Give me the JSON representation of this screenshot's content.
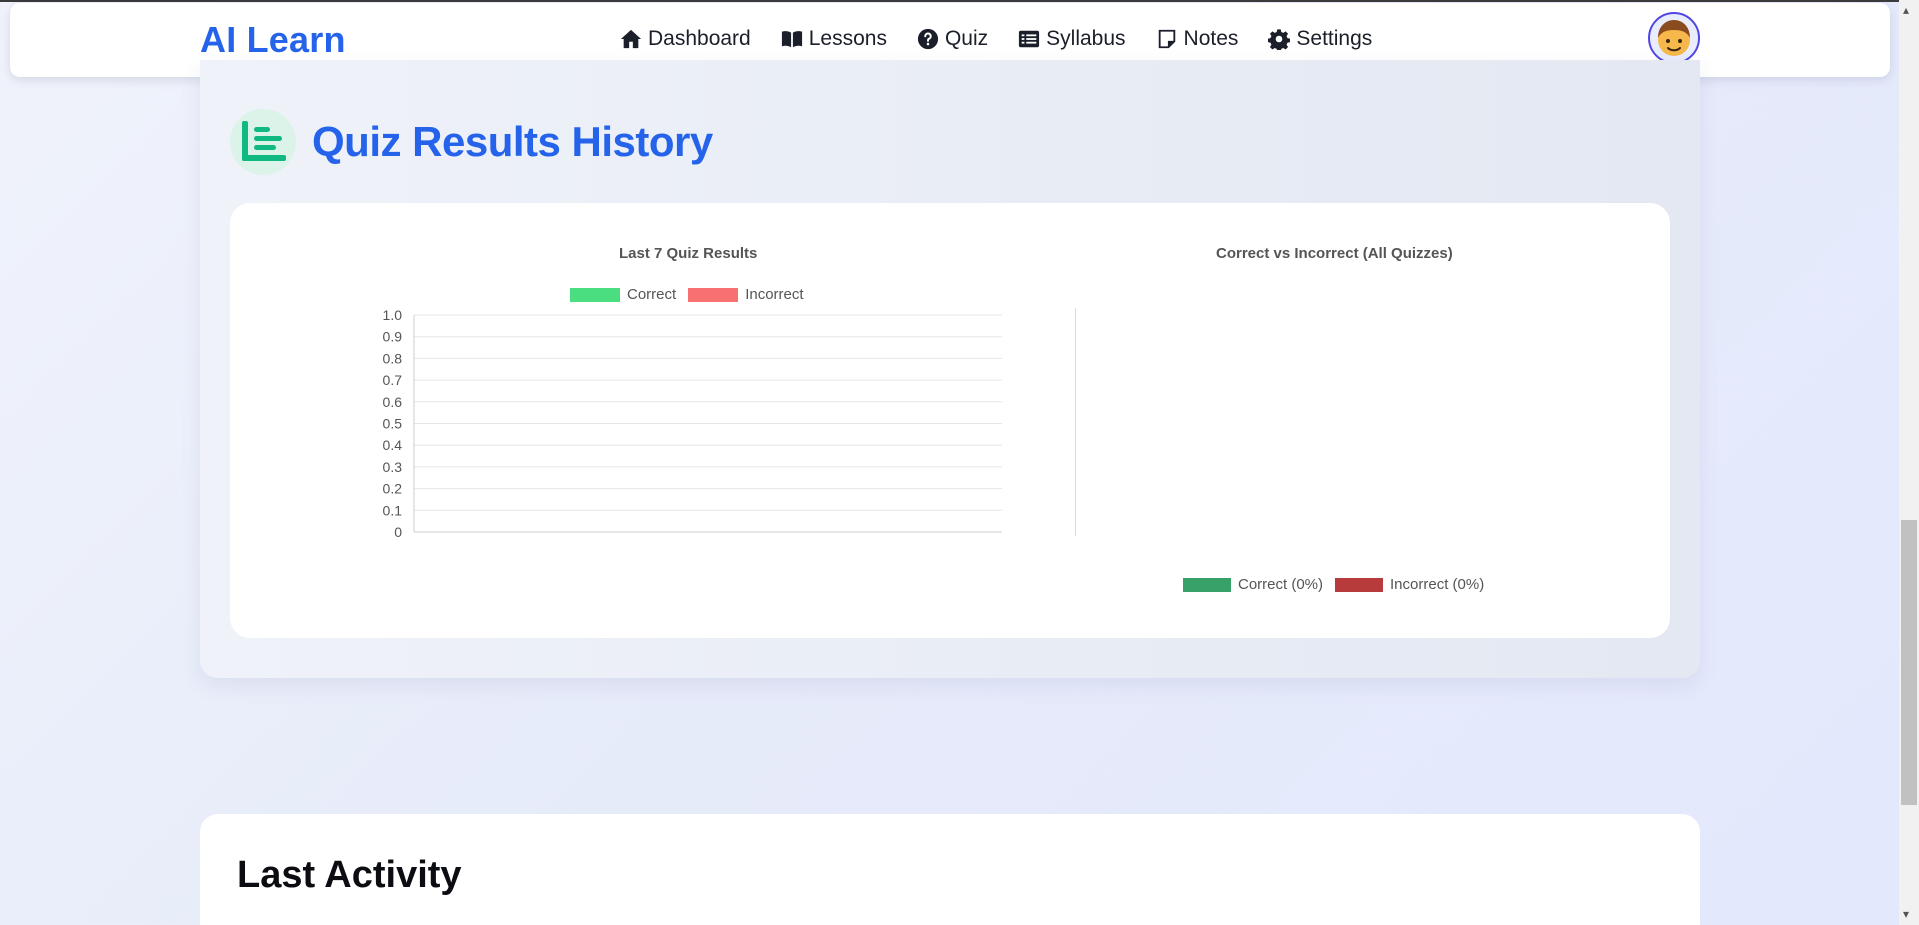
{
  "brand": "AI Learn",
  "nav": [
    {
      "label": "Dashboard",
      "icon": "home-icon"
    },
    {
      "label": "Lessons",
      "icon": "book-icon"
    },
    {
      "label": "Quiz",
      "icon": "question-circle-icon"
    },
    {
      "label": "Syllabus",
      "icon": "list-icon"
    },
    {
      "label": "Notes",
      "icon": "note-icon"
    },
    {
      "label": "Settings",
      "icon": "gear-icon"
    }
  ],
  "section": {
    "title": "Quiz Results History",
    "icon": "bar-chart-icon"
  },
  "chart_data": [
    {
      "type": "bar",
      "title": "Last 7 Quiz Results",
      "categories": [],
      "series": [
        {
          "name": "Correct",
          "values": [],
          "color": "#4ade80"
        },
        {
          "name": "Incorrect",
          "values": [],
          "color": "#f87171"
        }
      ],
      "ylim": [
        0,
        1.0
      ],
      "yticks": [
        "1.0",
        "0.9",
        "0.8",
        "0.7",
        "0.6",
        "0.5",
        "0.4",
        "0.3",
        "0.2",
        "0.1",
        "0"
      ],
      "grid": true,
      "legend": "top"
    },
    {
      "type": "pie",
      "title": "Correct vs Incorrect (All Quizzes)",
      "labels": [
        "Correct (0%)",
        "Incorrect (0%)"
      ],
      "values": [
        0,
        0
      ],
      "colors": [
        "#38a169",
        "#b83b3b"
      ],
      "legend": "bottom"
    }
  ],
  "activity": {
    "title": "Last Activity"
  },
  "colors": {
    "brand": "#2563eb",
    "accent_green": "#10b981"
  }
}
